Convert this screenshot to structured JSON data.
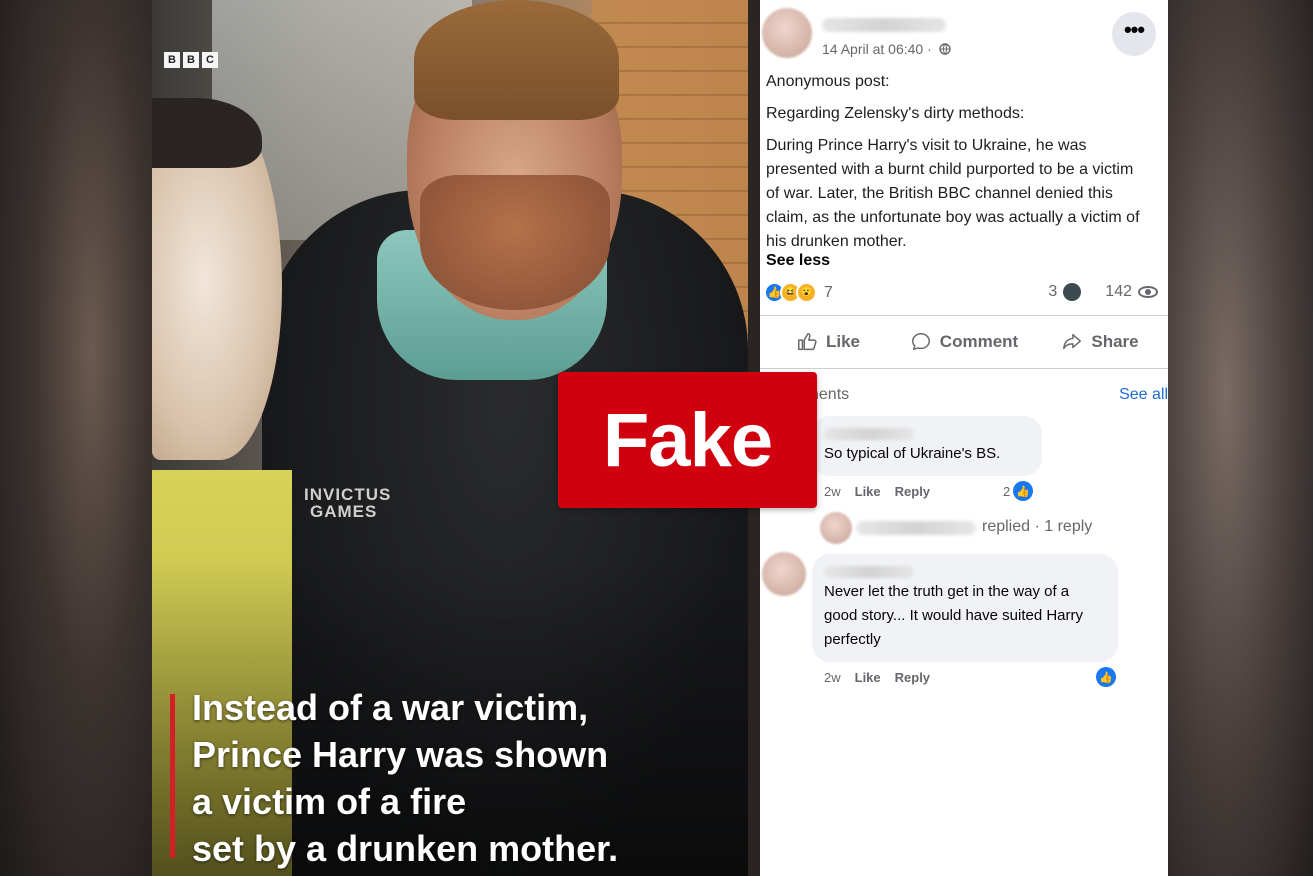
{
  "video": {
    "broadcaster_logo": [
      "B",
      "B",
      "C"
    ],
    "jacket_logo": [
      "INVICTUS",
      "GAMES"
    ],
    "caption_lines": [
      "Instead of a war victim,",
      "Prince Harry was shown",
      "a victim of a fire",
      "set by a drunken mother."
    ]
  },
  "badge": {
    "label": "Fake",
    "color": "#d0000f"
  },
  "post": {
    "timestamp": "14 April at 06:40 ·",
    "audience_icon": "globe-icon",
    "more_label": "•••",
    "paragraphs": [
      "Anonymous post:",
      "Regarding Zelensky's dirty methods:",
      "During Prince Harry's visit to Ukraine, he was presented with a burnt child purported to be a victim of war. Later, the British BBC channel denied this claim, as the unfortunate boy was actually a victim of his drunken mother."
    ],
    "see_less": "See less",
    "reaction_count": "7",
    "comment_count": "3",
    "view_count": "142",
    "actions": {
      "like": "Like",
      "comment": "Comment",
      "share": "Share"
    },
    "comments_header": "nents",
    "see_all": "See all",
    "comments": [
      {
        "text": "So typical of Ukraine's BS.",
        "time": "2w",
        "like": "Like",
        "reply": "Reply",
        "likes": "2"
      },
      {
        "text": "Never let the truth get in the way of a good story... It would have suited Harry perfectly",
        "time": "2w",
        "like": "Like",
        "reply": "Reply",
        "likes": ""
      }
    ],
    "replied_text": "replied · 1 reply"
  },
  "colors": {
    "facebook_blue": "#1877f2",
    "link_blue": "#1f6dd1",
    "muted_gray": "#65676b",
    "bbc_red": "#d31f26"
  }
}
